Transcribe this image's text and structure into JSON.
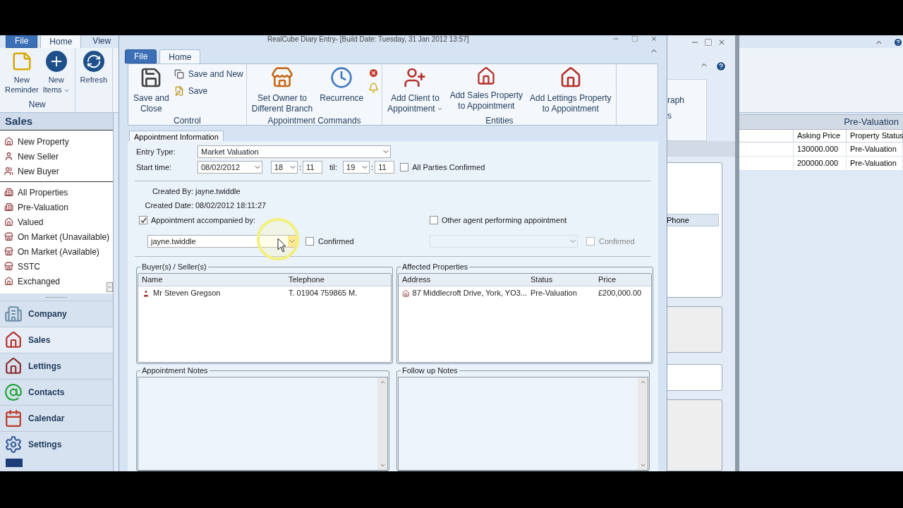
{
  "app": {
    "tabs": [
      {
        "label": "File",
        "kind": "menu"
      },
      {
        "label": "Home",
        "kind": "tab",
        "selected": true
      },
      {
        "label": "View",
        "kind": "tab",
        "selected": false
      }
    ],
    "ribbon_groups": [
      {
        "label": "New",
        "buttons": [
          {
            "label": "New\nReminder",
            "dropdown": false
          },
          {
            "label": "New\nItems",
            "dropdown": true
          }
        ]
      },
      {
        "buttons": [
          {
            "label": "Refresh",
            "dropdown": false
          }
        ]
      }
    ],
    "sidebar": {
      "title": "Sales",
      "sections": [
        [
          {
            "label": "New Property"
          },
          {
            "label": "New Seller"
          },
          {
            "label": "New Buyer"
          }
        ],
        [
          {
            "label": "All Properties"
          },
          {
            "label": "Pre-Valuation"
          },
          {
            "label": "Valued"
          },
          {
            "label": "On Market (Unavailable)"
          },
          {
            "label": "On Market (Available)"
          },
          {
            "label": "SSTC"
          },
          {
            "label": "Exchanged"
          }
        ]
      ],
      "nav": [
        {
          "label": "Company",
          "selected": false
        },
        {
          "label": "Sales",
          "selected": true
        },
        {
          "label": "Lettings",
          "selected": false
        },
        {
          "label": "Contacts",
          "selected": false
        },
        {
          "label": "Calendar",
          "selected": false
        },
        {
          "label": "Settings",
          "selected": false
        }
      ]
    },
    "grid": {
      "group_title": "Pre-Valuation",
      "columns": [
        "Asking Price",
        "Property Status"
      ],
      "rows": [
        [
          "130000.000",
          "Pre-Valuation"
        ],
        [
          "200000.000",
          "Pre-Valuation"
        ]
      ]
    }
  },
  "middle_window": {
    "ribbon_fragments": [
      "raph",
      "s"
    ],
    "cell": "Phone"
  },
  "dialog": {
    "title": "RealCube Diary Entry- [Build Date: Tuesday, 31 Jan 2012 13:57]",
    "tabs": [
      {
        "label": "File",
        "kind": "menu"
      },
      {
        "label": "Home",
        "kind": "tab",
        "selected": true
      }
    ],
    "ribbon_groups": [
      {
        "label": "Control",
        "large": [
          {
            "label": "Save and\nClose",
            "dropdown": false
          }
        ],
        "small": [
          {
            "kind": "labeled",
            "label": "Save and New"
          },
          {
            "kind": "labeled",
            "label": "Save"
          }
        ]
      },
      {
        "label": "Appointment Commands",
        "large": [
          {
            "label": "Set Owner to\nDifferent Branch",
            "dropdown": false
          },
          {
            "label": "Recurrence",
            "dropdown": false
          }
        ],
        "small": [
          {
            "kind": "icon"
          },
          {
            "kind": "icon"
          }
        ]
      },
      {
        "label": "Entities",
        "large": [
          {
            "label": "Add Client to\nAppointment",
            "dropdown": true
          },
          {
            "label": "Add Sales Property\nto Appointment",
            "dropdown": false
          },
          {
            "label": "Add Lettings Property\nto Appointment",
            "dropdown": false
          }
        ]
      }
    ],
    "section_tab": {
      "label": "Appointment Information",
      "selected": true
    },
    "form": {
      "entry_type": {
        "label": "Entry Type:",
        "value": "Market Valuation"
      },
      "start": {
        "label": "Start time:",
        "date": "08/02/2012",
        "hour_from": "18",
        "separator_from": ":",
        "min_from": "11",
        "til": "til:",
        "hour_to": "19",
        "separator_to": ":",
        "min_to": "11"
      },
      "all_parties": {
        "label": "All Parties Confirmed",
        "checked": false
      },
      "created_by": {
        "label": "Created By:",
        "value": "jayne.twiddle"
      },
      "created_date": {
        "label": "Created Date:",
        "value": "08/02/2012 18:11:27"
      },
      "accompanied": {
        "label": "Appointment accompanied by:",
        "checked": true,
        "value": "jayne.twiddle",
        "disabled": false,
        "confirmed": {
          "label": "Confirmed",
          "checked": false
        }
      },
      "other_agent": {
        "label": "Other agent performing appointment",
        "checked": false,
        "disabled": true,
        "confirmed": {
          "label": "Confirmed",
          "checked": false
        }
      },
      "buyers_sellers": {
        "title": "Buyer(s) / Seller(s)",
        "columns": [
          "Name",
          "Telephone"
        ],
        "rows": [
          [
            "Mr Steven Gregson",
            "T. 01904 759865 M."
          ]
        ]
      },
      "affected_properties": {
        "title": "Affected Properties",
        "columns": [
          "Address",
          "Status",
          "Price"
        ],
        "rows": [
          [
            "87 Middlecroft Drive, York, YO3...",
            "Pre-Valuation",
            "£200,000.00"
          ]
        ]
      },
      "notes": [
        {
          "title": "Appointment Notes"
        },
        {
          "title": "Follow up Notes"
        }
      ]
    }
  }
}
